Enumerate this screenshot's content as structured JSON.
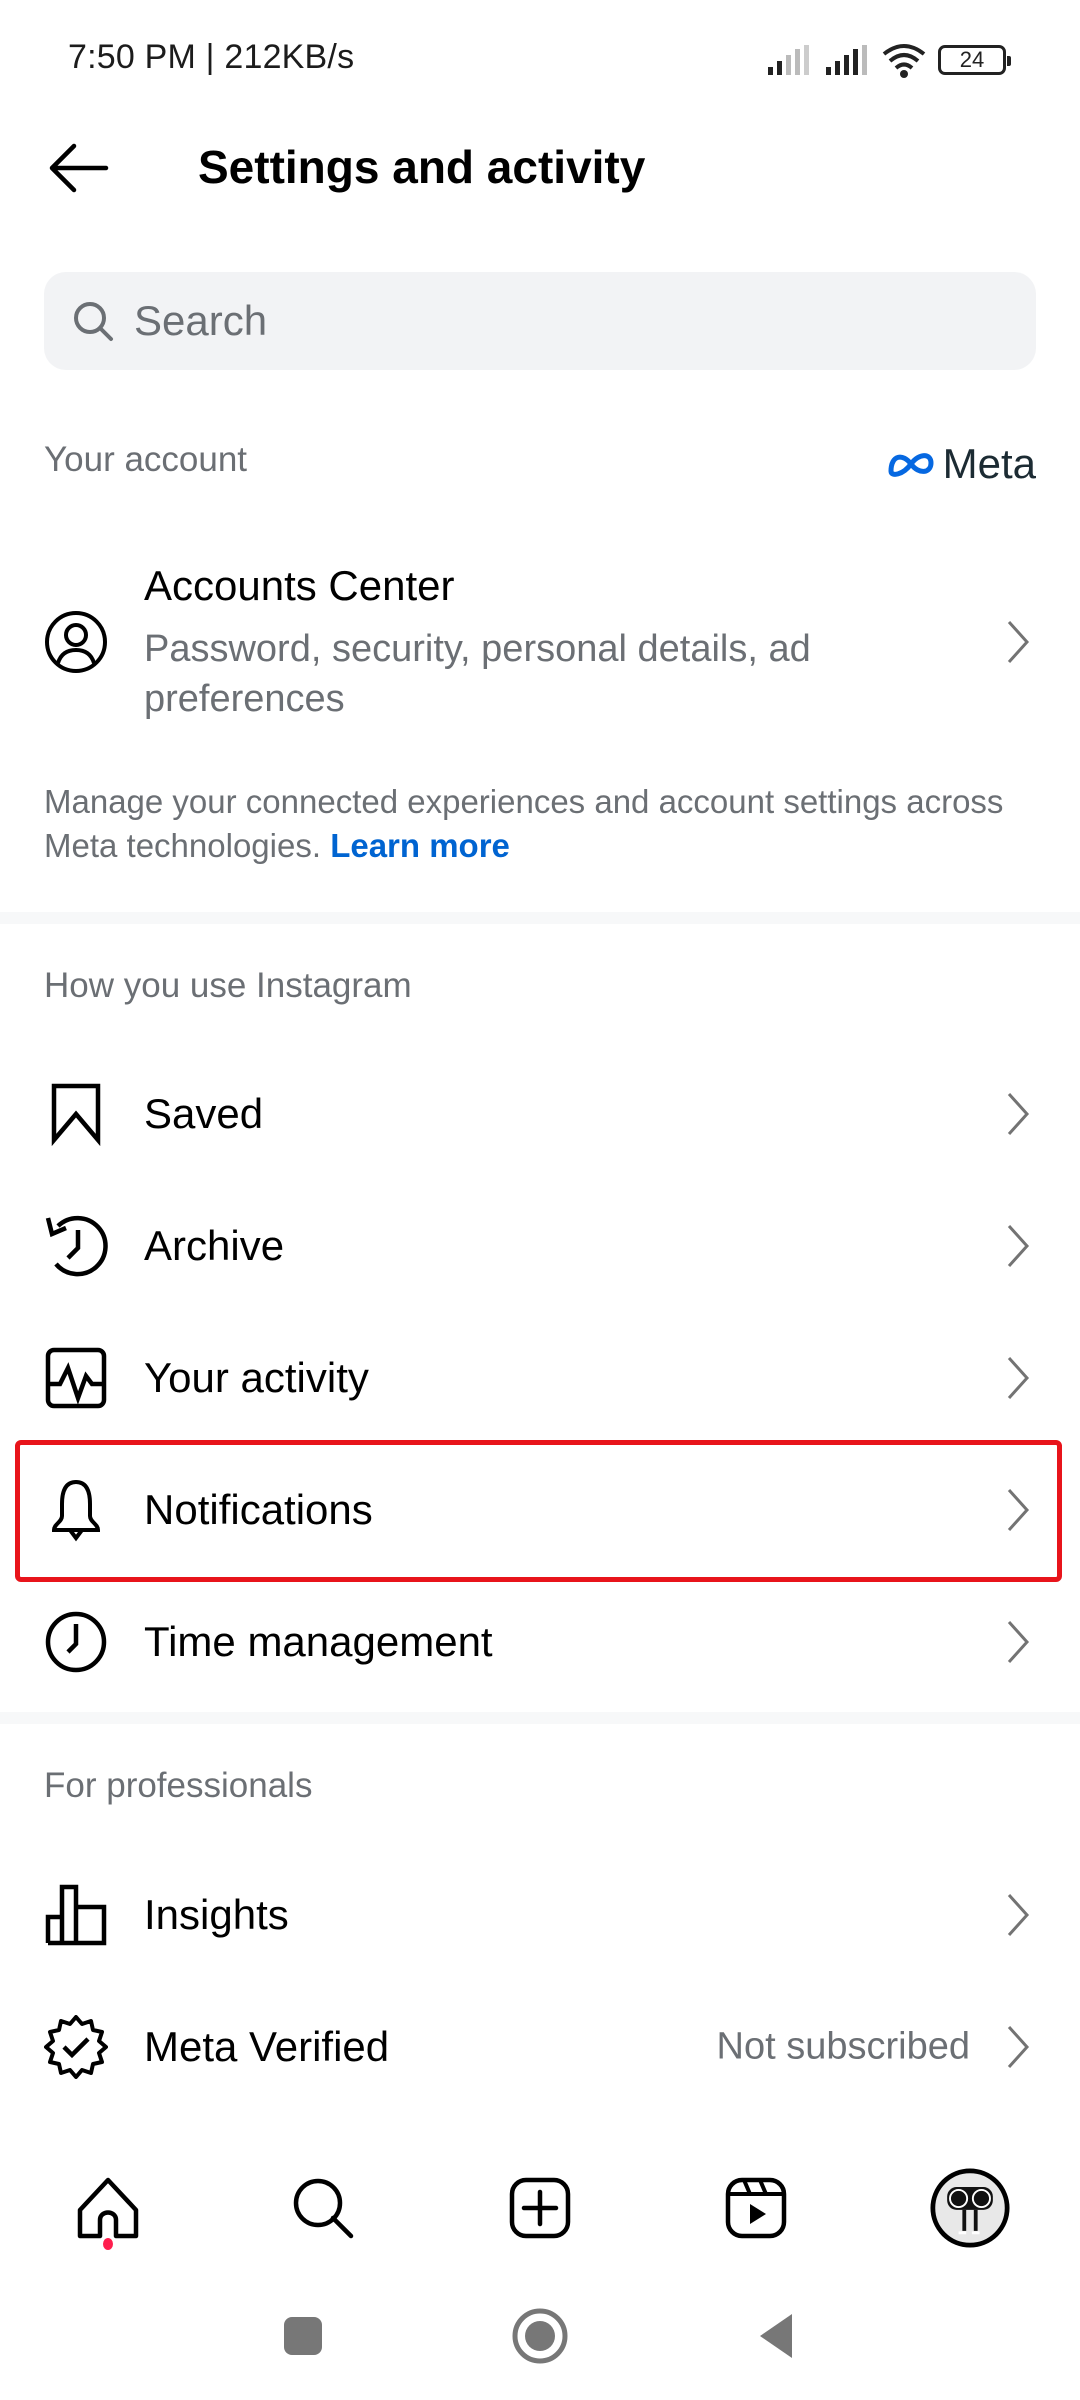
{
  "status_bar": {
    "time_speed": "7:50 PM | 212KB/s",
    "battery": "24",
    "icons": [
      "signal-icon",
      "signal-icon",
      "wifi-icon",
      "battery-icon"
    ]
  },
  "header": {
    "title": "Settings and activity",
    "back_icon": "arrow-left-icon"
  },
  "search": {
    "placeholder": "Search",
    "icon": "search-icon"
  },
  "your_account": {
    "label": "Your account",
    "meta_logo_text": "Meta",
    "accounts_center": {
      "title": "Accounts Center",
      "subtitle": "Password, security, personal details, ad preferences"
    },
    "info_text": "Manage your connected experiences and account settings across Meta technologies.",
    "learn_more": "Learn more"
  },
  "how_you_use": {
    "label": "How you use Instagram",
    "items": [
      {
        "label": "Saved",
        "icon": "bookmark-icon"
      },
      {
        "label": "Archive",
        "icon": "archive-clock-icon"
      },
      {
        "label": "Your activity",
        "icon": "activity-icon"
      },
      {
        "label": "Notifications",
        "icon": "bell-icon",
        "highlighted": true
      },
      {
        "label": "Time management",
        "icon": "clock-icon"
      }
    ]
  },
  "for_professionals": {
    "label": "For professionals",
    "items": [
      {
        "label": "Insights",
        "icon": "bar-chart-icon"
      },
      {
        "label": "Meta Verified",
        "icon": "verified-badge-icon",
        "value": "Not subscribed"
      }
    ]
  },
  "bottom_nav": {
    "items": [
      "home-icon",
      "search-icon",
      "create-icon",
      "reels-icon",
      "profile-avatar"
    ]
  },
  "colors": {
    "highlight": "#e8141b",
    "link": "#0064d1",
    "notification_dot": "#ff1e4e",
    "meta_blue": "#0668e1"
  }
}
